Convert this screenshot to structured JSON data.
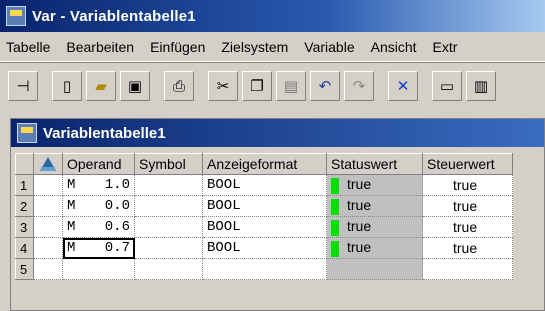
{
  "app": {
    "title": "Var - Variablentabelle1"
  },
  "menu": [
    "Tabelle",
    "Bearbeiten",
    "Einfügen",
    "Zielsystem",
    "Variable",
    "Ansicht",
    "Extr"
  ],
  "toolbar_icons": [
    "pin-icon",
    "new-file-icon",
    "open-folder-icon",
    "save-icon",
    "print-icon",
    "cut-icon",
    "copy-icon",
    "paste-icon",
    "undo-icon",
    "redo-icon",
    "delete-icon",
    "monitor-icon",
    "module-icon"
  ],
  "child_window": {
    "title": "Variablentabelle1"
  },
  "table": {
    "headers": [
      "Operand",
      "Symbol",
      "Anzeigeformat",
      "Statuswert",
      "Steuerwert"
    ],
    "rows": [
      {
        "num": "1",
        "area": "M",
        "addr": "1.0",
        "symbol": "",
        "format": "BOOL",
        "status": "true",
        "control": "true"
      },
      {
        "num": "2",
        "area": "M",
        "addr": "0.0",
        "symbol": "",
        "format": "BOOL",
        "status": "true",
        "control": "true"
      },
      {
        "num": "3",
        "area": "M",
        "addr": "0.6",
        "symbol": "",
        "format": "BOOL",
        "status": "true",
        "control": "true"
      },
      {
        "num": "4",
        "area": "M",
        "addr": "0.7",
        "symbol": "",
        "format": "BOOL",
        "status": "true",
        "control": "true"
      },
      {
        "num": "5",
        "area": "",
        "addr": "",
        "symbol": "",
        "format": "",
        "status": "",
        "control": ""
      }
    ]
  },
  "colors": {
    "title_bar": "#08246b",
    "status_indicator": "#00e000"
  }
}
